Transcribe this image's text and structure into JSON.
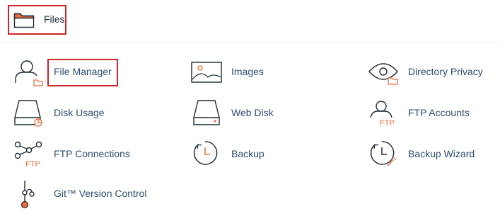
{
  "section": {
    "title": "Files",
    "icon": "folder-icon"
  },
  "items": [
    {
      "label": "File Manager",
      "icon": "file-manager-icon"
    },
    {
      "label": "Images",
      "icon": "image-icon"
    },
    {
      "label": "Directory Privacy",
      "icon": "eye-folder-icon"
    },
    {
      "label": "Disk Usage",
      "icon": "disk-usage-icon"
    },
    {
      "label": "Web Disk",
      "icon": "hard-drive-icon"
    },
    {
      "label": "FTP Accounts",
      "icon": "ftp-user-icon"
    },
    {
      "label": "FTP Connections",
      "icon": "network-ftp-icon"
    },
    {
      "label": "Backup",
      "icon": "clock-icon"
    },
    {
      "label": "Backup Wizard",
      "icon": "clock-wand-icon"
    },
    {
      "label": "Git™ Version Control",
      "icon": "git-branch-icon"
    }
  ],
  "colors": {
    "accent": "#f06a35",
    "link": "#2e4c6e",
    "highlight": "#d0232a",
    "icon_stroke": "#1f2d3a"
  },
  "icon_text": {
    "ftp": "FTP"
  }
}
